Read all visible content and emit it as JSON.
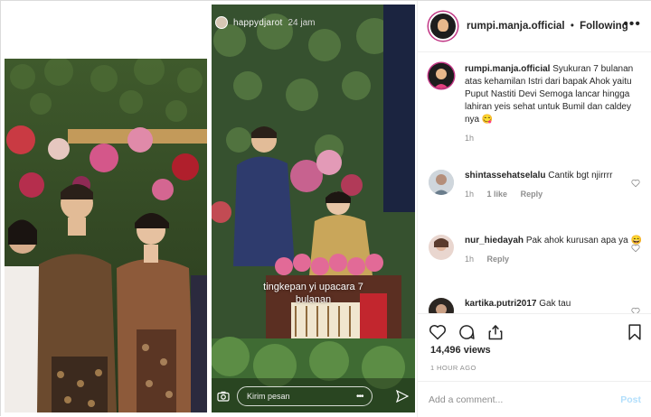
{
  "media": {
    "story": {
      "username": "happydjarot",
      "time": "24 jam",
      "caption_lines": [
        "tingkepan yi upacara 7",
        "bulanan"
      ],
      "message_placeholder": "Kirim pesan"
    }
  },
  "header": {
    "username": "rumpi.manja.official",
    "separator": "•",
    "follow_status": "Following",
    "more_label": "•••"
  },
  "caption": {
    "username": "rumpi.manja.official",
    "text": "Syukuran 7 bulanan atas kehamilan Istri dari bapak Ahok yaitu Puput Nastiti Devi Semoga lancar hingga lahiran yeis sehat untuk Bumil dan caldey nya 😋",
    "time": "1h"
  },
  "comments": [
    {
      "username": "shintassehatselalu",
      "text": "Cantik bgt njirrrr",
      "time": "1h",
      "likes": "1 like",
      "reply": "Reply"
    },
    {
      "username": "nur_hiedayah",
      "text": "Pak ahok kurusan apa ya 😄",
      "time": "1h",
      "likes": "",
      "reply": "Reply"
    },
    {
      "username": "kartika.putri2017",
      "text": "Gak tau",
      "time": "",
      "likes": "",
      "reply": ""
    }
  ],
  "stats": {
    "views": "14,496 views",
    "ago": "1 HOUR AGO"
  },
  "add_comment": {
    "placeholder": "Add a comment...",
    "post_label": "Post"
  },
  "colors": {
    "accent_blue_disabled": "#b2dffc",
    "muted": "#8e8e8e",
    "border": "#efefef",
    "text": "#262626"
  }
}
